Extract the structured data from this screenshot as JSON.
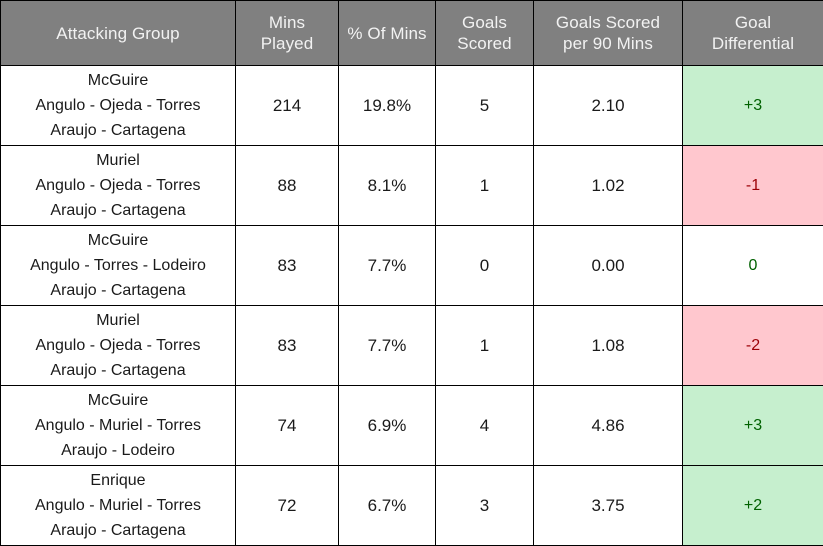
{
  "table": {
    "columns": [
      {
        "key": "group",
        "header_lines": [
          "Attacking Group"
        ]
      },
      {
        "key": "mins",
        "header_lines": [
          "Mins",
          "Played"
        ]
      },
      {
        "key": "pct",
        "header_lines": [
          "% Of Mins"
        ]
      },
      {
        "key": "goals",
        "header_lines": [
          "Goals",
          "Scored"
        ]
      },
      {
        "key": "per90",
        "header_lines": [
          "Goals Scored",
          "per 90 Mins"
        ]
      },
      {
        "key": "diff",
        "header_lines": [
          "Goal",
          "Differential"
        ]
      }
    ],
    "rows": [
      {
        "group_lines": [
          "McGuire",
          "Angulo - Ojeda - Torres",
          "Araujo - Cartagena"
        ],
        "mins": "214",
        "pct": "19.8%",
        "goals": "5",
        "per90": "2.10",
        "diff": "+3",
        "diff_state": "positive"
      },
      {
        "group_lines": [
          "Muriel",
          "Angulo - Ojeda - Torres",
          "Araujo - Cartagena"
        ],
        "mins": "88",
        "pct": "8.1%",
        "goals": "1",
        "per90": "1.02",
        "diff": "-1",
        "diff_state": "negative"
      },
      {
        "group_lines": [
          "McGuire",
          "Angulo - Torres - Lodeiro",
          "Araujo - Cartagena"
        ],
        "mins": "83",
        "pct": "7.7%",
        "goals": "0",
        "per90": "0.00",
        "diff": "0",
        "diff_state": "zero"
      },
      {
        "group_lines": [
          "Muriel",
          "Angulo - Ojeda - Torres",
          "Araujo - Cartagena"
        ],
        "mins": "83",
        "pct": "7.7%",
        "goals": "1",
        "per90": "1.08",
        "diff": "-2",
        "diff_state": "negative"
      },
      {
        "group_lines": [
          "McGuire",
          "Angulo - Muriel - Torres",
          "Araujo - Lodeiro"
        ],
        "mins": "74",
        "pct": "6.9%",
        "goals": "4",
        "per90": "4.86",
        "diff": "+3",
        "diff_state": "positive"
      },
      {
        "group_lines": [
          "Enrique",
          "Angulo - Muriel - Torres",
          "Araujo - Cartagena"
        ],
        "mins": "72",
        "pct": "6.7%",
        "goals": "3",
        "per90": "3.75",
        "diff": "+2",
        "diff_state": "zero_placeholder_unused"
      }
    ]
  },
  "colors": {
    "header_background": "#808080",
    "header_text": "#F2F2F2",
    "body_text": "#1A1A1A",
    "positive_fill": "#C6EFCE",
    "positive_text": "#006100",
    "negative_fill": "#FFC7CE",
    "negative_text": "#9C0006",
    "grid_line": "#000000"
  }
}
